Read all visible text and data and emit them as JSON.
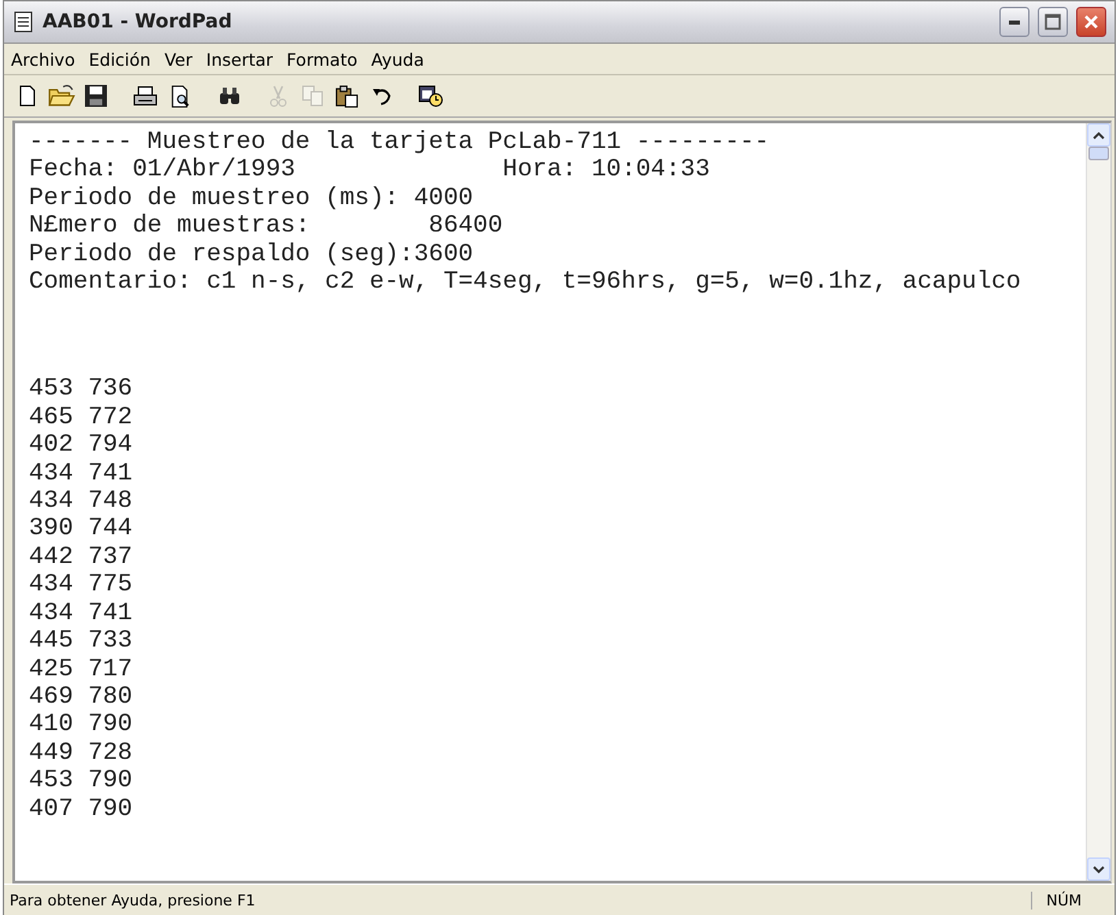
{
  "window": {
    "title": "AAB01 - WordPad"
  },
  "menu": [
    "Archivo",
    "Edición",
    "Ver",
    "Insertar",
    "Formato",
    "Ayuda"
  ],
  "toolbar_groups": [
    {
      "tools": [
        {
          "kind": "new",
          "disabled": false
        },
        {
          "kind": "open",
          "disabled": false
        },
        {
          "kind": "save",
          "disabled": false
        }
      ]
    },
    {
      "tools": [
        {
          "kind": "print",
          "disabled": false
        },
        {
          "kind": "preview",
          "disabled": false
        }
      ]
    },
    {
      "tools": [
        {
          "kind": "find",
          "disabled": false
        }
      ]
    },
    {
      "tools": [
        {
          "kind": "cut",
          "disabled": true
        },
        {
          "kind": "copy",
          "disabled": true
        },
        {
          "kind": "paste",
          "disabled": false
        },
        {
          "kind": "undo",
          "disabled": false
        }
      ]
    },
    {
      "tools": [
        {
          "kind": "datetime",
          "disabled": false
        }
      ]
    }
  ],
  "document": {
    "header": [
      "------- Muestreo de la tarjeta PcLab-711 ---------",
      "Fecha: 01/Abr/1993              Hora: 10:04:33",
      "Periodo de muestreo (ms): 4000",
      "N£mero de muestras:        86400",
      "Periodo de respaldo (seg):3600",
      "Comentario: c1 n-s, c2 e-w, T=4seg, t=96hrs, g=5, w=0.1hz, acapulco"
    ],
    "rows": [
      "453 736",
      "465 772",
      "402 794",
      "434 741",
      "434 748",
      "390 744",
      "442 737",
      "434 775",
      "434 741",
      "445 733",
      "425 717",
      "469 780",
      "410 790",
      "449 728",
      "453 790",
      "407 790"
    ]
  },
  "status_bar": {
    "message": "Para obtener Ayuda, presione F1",
    "indicator": "NÚM"
  }
}
